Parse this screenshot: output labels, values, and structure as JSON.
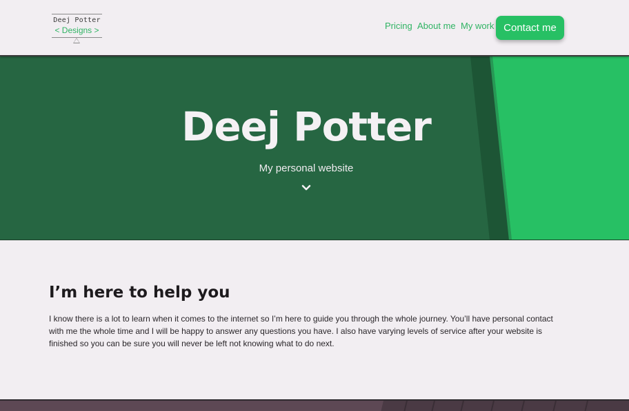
{
  "logo": {
    "line1": "Deej Potter",
    "line2": "< Designs >"
  },
  "nav": {
    "pricing": "Pricing",
    "about": "About me",
    "work": "My work",
    "contact": "Contact me"
  },
  "hero": {
    "title": "Deej Potter",
    "subtitle": "My personal website",
    "scroll_icon": "chevron-down-icon"
  },
  "intro": {
    "heading": "I’m here to help you",
    "body": "I know there is a lot to learn when it comes to the internet so I’m here to guide you through the whole journey. You’ll have personal contact with me the whole time and I will be happy to answer any questions you have. I also have varying levels of service after your website is finished so you can be sure you will never be left not knowing what to do next."
  },
  "colors": {
    "accent": "#27c064",
    "hero_dark": "#266642",
    "background": "#f2eef2"
  }
}
